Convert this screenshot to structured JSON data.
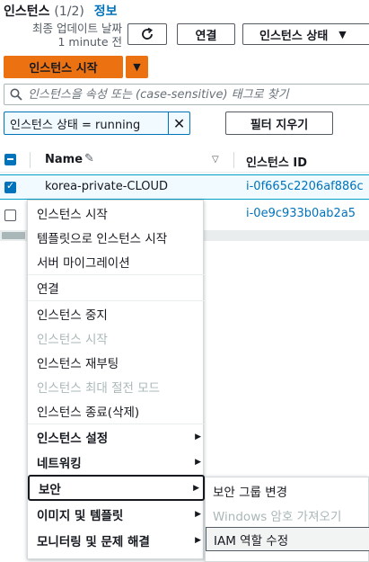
{
  "header": {
    "title": "인스턴스",
    "count": "(1/2)",
    "info_link": "정보",
    "last_updated_label": "최종 업데이트 날짜",
    "last_updated_value": "1 minute 전",
    "connect_button": "연결",
    "instance_state_button": "인스턴스 상태",
    "launch_button": "인스턴스 시작"
  },
  "search": {
    "placeholder": "인스턴스을 속성 또는 (case-sensitive) 태그로 찾기"
  },
  "filter": {
    "token": "인스턴스 상태 = running",
    "clear_button": "필터 지우기"
  },
  "table": {
    "columns": [
      "Name",
      "인스턴스 ID"
    ],
    "rows": [
      {
        "name": "korea-private-CLOUD",
        "instance_id": "i-0f665c2206af886c",
        "selected": true
      },
      {
        "name": "",
        "instance_id": "i-0e9c933b0ab2a5",
        "selected": false
      }
    ]
  },
  "context_menu": {
    "items": [
      {
        "label": "인스턴스 시작",
        "enabled": true
      },
      {
        "label": "템플릿으로 인스턴스 시작",
        "enabled": true
      },
      {
        "label": "서버 마이그레이션",
        "enabled": true
      },
      {
        "label": "연결",
        "enabled": true
      },
      {
        "label": "인스턴스 중지",
        "enabled": true
      },
      {
        "label": "인스턴스 시작",
        "enabled": false
      },
      {
        "label": "인스턴스 재부팅",
        "enabled": true
      },
      {
        "label": "인스턴스 최대 절전 모드",
        "enabled": false
      },
      {
        "label": "인스턴스 종료(삭제)",
        "enabled": true
      },
      {
        "label": "인스턴스 설정",
        "enabled": true,
        "submenu": true
      },
      {
        "label": "네트워킹",
        "enabled": true,
        "submenu": true
      },
      {
        "label": "보안",
        "enabled": true,
        "submenu": true,
        "active": true
      },
      {
        "label": "이미지 및 템플릿",
        "enabled": true,
        "submenu": true
      },
      {
        "label": "모니터링 및 문제 해결",
        "enabled": true,
        "submenu": true
      }
    ]
  },
  "security_submenu": {
    "items": [
      {
        "label": "보안 그룹 변경",
        "enabled": true
      },
      {
        "label": "Windows 암호 가져오기",
        "enabled": false
      },
      {
        "label": "IAM 역할 수정",
        "enabled": true,
        "hovered": true
      }
    ]
  },
  "icons": {
    "refresh": "refresh-icon",
    "caret": "caret-down-icon",
    "search": "search-icon",
    "close": "close-icon",
    "edit": "pencil-icon",
    "sort": "sort-down-icon",
    "submenu_arrow": "caret-right-icon"
  },
  "colors": {
    "primary_orange": "#ec7211",
    "link_blue": "#0073bb",
    "selected_row_bg": "#f1faff",
    "disabled_text": "#aab7b8"
  }
}
